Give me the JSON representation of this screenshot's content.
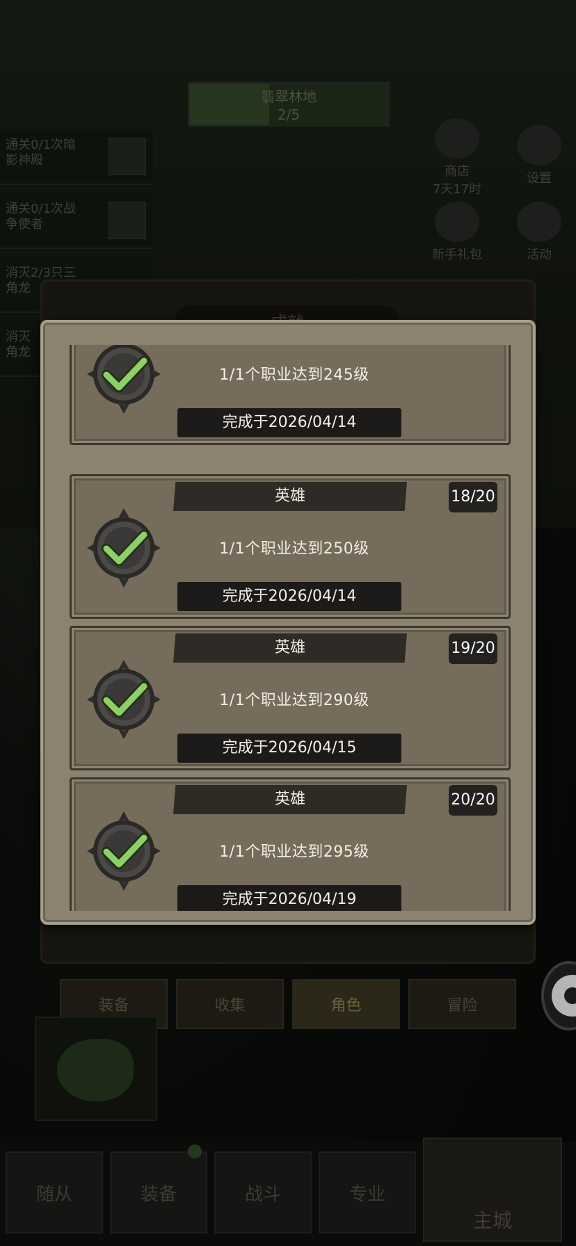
{
  "background": {
    "stage": {
      "name": "翡翠林地",
      "progress": "2/5"
    },
    "quests": [
      {
        "line1": "通关0/1次暗",
        "line2": "影神殿"
      },
      {
        "line1": "通关0/1次战",
        "line2": "争使者"
      },
      {
        "line1": "消灭2/3只三",
        "line2": "角龙"
      },
      {
        "line1": "消灭",
        "line2": "角龙"
      }
    ],
    "side_buttons": [
      {
        "label": "商店",
        "sub": "7天17时"
      },
      {
        "label": "设置",
        "sub": ""
      },
      {
        "label": "新手礼包",
        "sub": ""
      },
      {
        "label": "活动",
        "sub": ""
      }
    ],
    "back_panel_title": "成就",
    "tabs": [
      "装备",
      "收集",
      "角色",
      "冒险"
    ],
    "active_tab": "角色",
    "bottom_nav": [
      "随从",
      "装备",
      "战斗",
      "专业"
    ],
    "bottom_nav_main": "主城"
  },
  "achievements": [
    {
      "rarity": "",
      "count": "",
      "desc": "1/1个职业达到245级",
      "date": "完成于2026/04/14",
      "completed": true
    },
    {
      "rarity": "英雄",
      "count": "18/20",
      "desc": "1/1个职业达到250级",
      "date": "完成于2026/04/14",
      "completed": true
    },
    {
      "rarity": "英雄",
      "count": "19/20",
      "desc": "1/1个职业达到290级",
      "date": "完成于2026/04/15",
      "completed": true
    },
    {
      "rarity": "英雄",
      "count": "20/20",
      "desc": "1/1个职业达到295级",
      "date": "完成于2026/04/19",
      "completed": true
    }
  ],
  "icons": {
    "badge": "checkmark-badge-icon",
    "settings": "gear-icon"
  },
  "colors": {
    "panel": "#8b8270",
    "card": "#756c5b",
    "check": "#8fcf68",
    "badge_dark": "#3b3a38"
  }
}
